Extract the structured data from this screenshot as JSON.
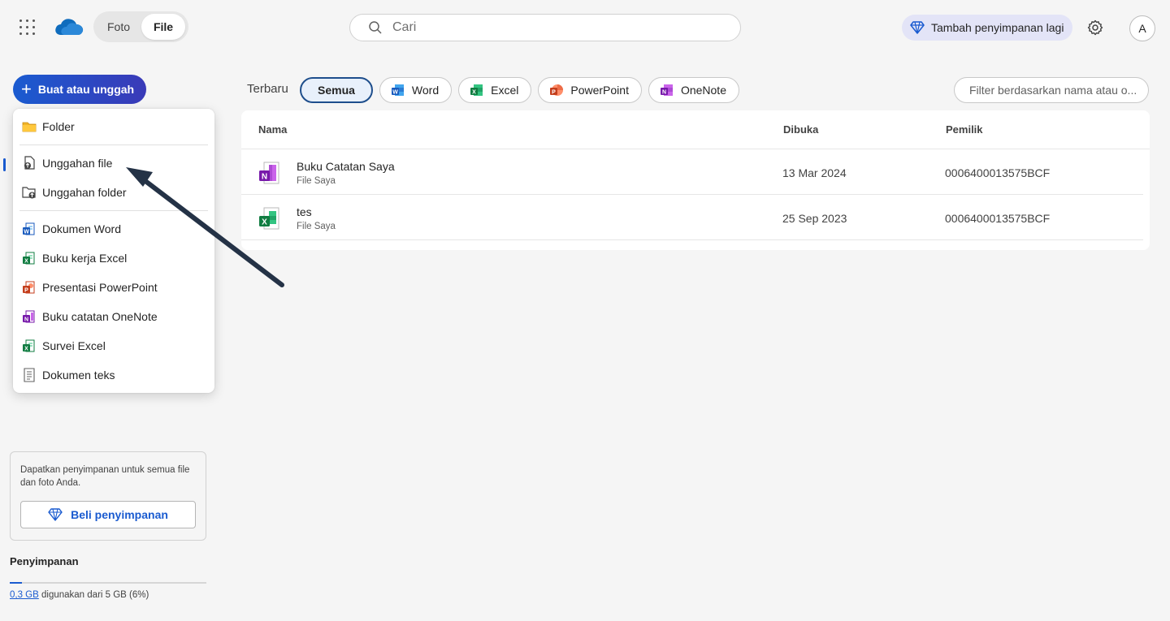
{
  "header": {
    "segments": [
      {
        "label": "Foto"
      },
      {
        "label": "File"
      }
    ],
    "search_placeholder": "Cari",
    "premium_label": "Tambah penyimpanan lagi",
    "avatar_initial": "A"
  },
  "create_button": {
    "label": "Buat atau unggah"
  },
  "menu": {
    "items": [
      {
        "label": "Folder"
      },
      {
        "label": "Unggahan file"
      },
      {
        "label": "Unggahan folder"
      },
      {
        "label": "Dokumen Word"
      },
      {
        "label": "Buku kerja Excel"
      },
      {
        "label": "Presentasi PowerPoint"
      },
      {
        "label": "Buku catatan OneNote"
      },
      {
        "label": "Survei Excel"
      },
      {
        "label": "Dokumen teks"
      }
    ]
  },
  "promo": {
    "text": "Dapatkan penyimpanan untuk semua file dan foto Anda.",
    "button_label": "Beli penyimpanan"
  },
  "storage": {
    "title": "Penyimpanan",
    "used": "0,3 GB",
    "rest": " digunakan dari 5 GB (6%)",
    "percent": 6
  },
  "filters": {
    "recent_label": "Terbaru",
    "pills": [
      {
        "label": "Semua"
      },
      {
        "label": "Word"
      },
      {
        "label": "Excel"
      },
      {
        "label": "PowerPoint"
      },
      {
        "label": "OneNote"
      }
    ],
    "filter_placeholder": "Filter berdasarkan nama atau o..."
  },
  "table": {
    "columns": {
      "name": "Nama",
      "opened": "Dibuka",
      "owner": "Pemilik"
    },
    "rows": [
      {
        "name": "Buku Catatan Saya",
        "location": "File Saya",
        "opened": "13 Mar 2024",
        "owner": "0006400013575BCF",
        "icon": "onenote-file-icon"
      },
      {
        "name": "tes",
        "location": "File Saya",
        "opened": "25 Sep 2023",
        "owner": "0006400013575BCF",
        "icon": "excel-file-icon"
      }
    ]
  },
  "colors": {
    "accent": "#1a5bd0",
    "word": "#185abd",
    "excel": "#107c41",
    "powerpoint": "#c43e1c",
    "onenote": "#7719aa",
    "annotation_arrow": "#243246"
  }
}
